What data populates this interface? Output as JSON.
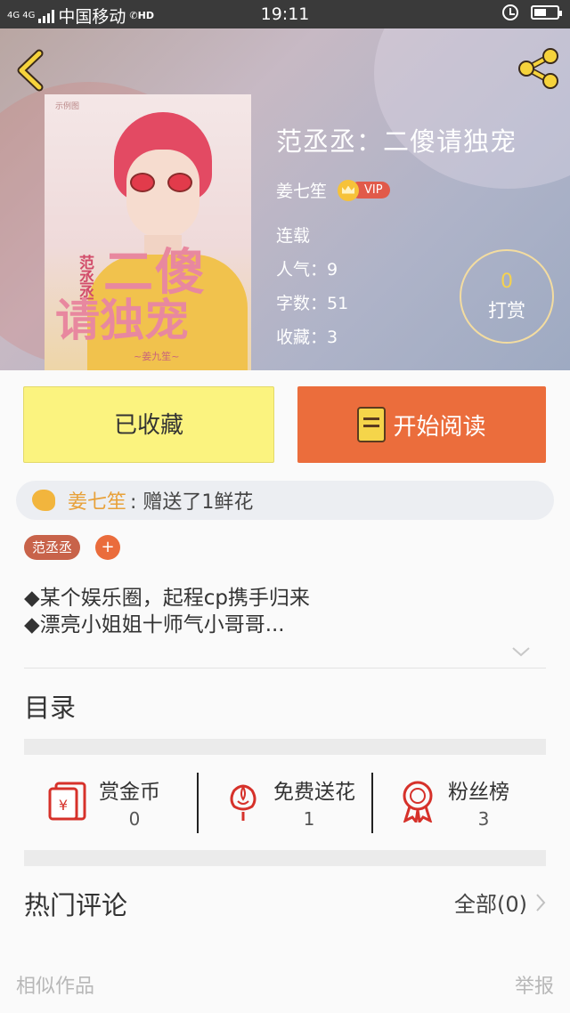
{
  "status_bar": {
    "signal": "4G 4G",
    "carrier": "中国移动",
    "hd": "HD",
    "time": "19:11"
  },
  "book": {
    "title": "范丞丞：二傻请独宠",
    "author": "姜七笙",
    "vip_badge": "VIP",
    "status": "连载",
    "popularity": "人气：9",
    "word_count": "字数：51",
    "favorites": "收藏：3"
  },
  "cover": {
    "tiny_text": "示例图",
    "band_text": "范丞丞",
    "big_line1": "二傻",
    "big_line2": "请独宠",
    "subtitle": "~姜九笙~"
  },
  "reward": {
    "count": "0",
    "label": "打赏"
  },
  "actions": {
    "collect_label": "已收藏",
    "read_label": "开始阅读"
  },
  "gift_feed": {
    "user": "姜七笙",
    "text": ": 赠送了1鲜花"
  },
  "tags": [
    "范丞丞"
  ],
  "tag_add": "+",
  "description": {
    "line1": "◆某个娱乐圈，起程cp携手归来",
    "line2": "◆漂亮小姐姐十师气小哥哥..."
  },
  "toc": {
    "title": "目录"
  },
  "stats": [
    {
      "label": "赏金币",
      "value": "0",
      "icon": "red-envelope-icon"
    },
    {
      "label": "免费送花",
      "value": "1",
      "icon": "flower-icon"
    },
    {
      "label": "粉丝榜",
      "value": "3",
      "icon": "medal-icon"
    }
  ],
  "comments": {
    "title": "热门评论",
    "all_label": "全部(0)"
  },
  "footer": {
    "similar": "相似作品",
    "report": "举报"
  },
  "colors": {
    "accent_orange": "#eb6d3c",
    "collect_yellow": "#fbf37f",
    "icon_red": "#d6312a",
    "reward_gold": "#f5d24f"
  }
}
